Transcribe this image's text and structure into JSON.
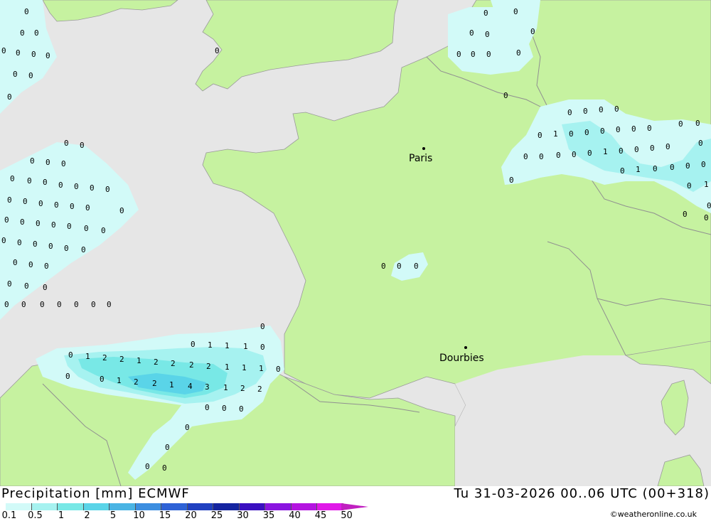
{
  "title_left": "Precipitation [mm] ECMWF",
  "title_right": "Tu 31-03-2026 00..06 UTC (00+318)",
  "credit": "©weatheronline.co.uk",
  "cities": [
    {
      "name": "Paris"
    },
    {
      "name": "Dourbies"
    }
  ],
  "legend": {
    "ticks": [
      "0.1",
      "0.5",
      "1",
      "2",
      "5",
      "10",
      "15",
      "20",
      "25",
      "30",
      "35",
      "40",
      "45",
      "50"
    ],
    "colors": [
      "#d2faf8",
      "#a6f2f0",
      "#78e8e6",
      "#5ad4e8",
      "#4ab4e4",
      "#3c8ee0",
      "#2e62d6",
      "#2040c0",
      "#1424a0",
      "#3a0fc0",
      "#8a14e0",
      "#b414e0",
      "#e018e8",
      "#c020c0"
    ]
  },
  "colors": {
    "sea": "#e6e6e6",
    "land": "#c6f2a0",
    "border": "#909090",
    "precip_light": "#d2faf8",
    "precip_mid": "#a6f2f0",
    "precip_high": "#78e8e6",
    "precip_max": "#5ad4e8"
  },
  "values": {
    "west_atlantic": [
      "0",
      "0",
      "0",
      "0",
      "0",
      "0",
      "0",
      "0",
      "0",
      "0"
    ],
    "biscay": [
      "0",
      "0",
      "0",
      "0",
      "0",
      "0",
      "0",
      "0",
      "0",
      "0",
      "0",
      "0",
      "0",
      "0",
      "0",
      "0",
      "0",
      "0",
      "0",
      "0",
      "0",
      "0",
      "0",
      "0",
      "0",
      "0",
      "0",
      "0",
      "0",
      "0",
      "0",
      "0",
      "0",
      "0",
      "0",
      "0",
      "0",
      "0",
      "0",
      "0",
      "0",
      "0",
      "0",
      "0",
      "0"
    ],
    "channel": [
      "0",
      "0",
      "0",
      "0",
      "0",
      "0",
      "0",
      "0",
      "0",
      "0",
      "0"
    ],
    "belgium": [
      "0",
      "0",
      "0",
      "0",
      "0",
      "1",
      "0",
      "0",
      "0",
      "0",
      "0",
      "0",
      "0",
      "0",
      "0",
      "0",
      "0",
      "0",
      "0",
      "1",
      "0",
      "0",
      "0",
      "0",
      "0",
      "0",
      "1",
      "0",
      "0",
      "0",
      "0",
      "0",
      "0",
      "1",
      "0",
      "0",
      "0"
    ],
    "central": [
      "0",
      "0",
      "0"
    ],
    "spain": [
      "0",
      "0",
      "1",
      "1",
      "1",
      "0",
      "0",
      "1",
      "2",
      "2",
      "1",
      "2",
      "2",
      "2",
      "2",
      "1",
      "1",
      "1",
      "0",
      "0",
      "0",
      "1",
      "2",
      "2",
      "1",
      "4",
      "3",
      "1",
      "2",
      "2",
      "0",
      "0",
      "0",
      "0",
      "0",
      "0",
      "0"
    ]
  }
}
